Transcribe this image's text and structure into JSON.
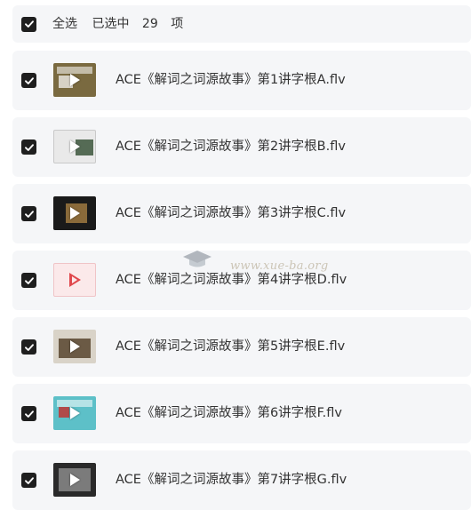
{
  "header": {
    "select_all": "全选",
    "selected_prefix": "已选中",
    "selected_count": "29",
    "selected_suffix": "项"
  },
  "files": [
    {
      "name": "ACE《解词之词源故事》第1讲字根A.flv"
    },
    {
      "name": "ACE《解词之词源故事》第2讲字根B.flv"
    },
    {
      "name": "ACE《解词之词源故事》第3讲字根C.flv"
    },
    {
      "name": "ACE《解词之词源故事》第4讲字根D.flv"
    },
    {
      "name": "ACE《解词之词源故事》第5讲字根E.flv"
    },
    {
      "name": "ACE《解词之词源故事》第6讲字根F.flv"
    },
    {
      "name": "ACE《解词之词源故事》第7讲字根G.flv"
    }
  ],
  "watermark": {
    "text": "www.xue-ba.org"
  },
  "colors": {
    "checkbox": "#1f1f1f",
    "row_bg": "#f5f6f8",
    "play_red": "#e0474c"
  }
}
